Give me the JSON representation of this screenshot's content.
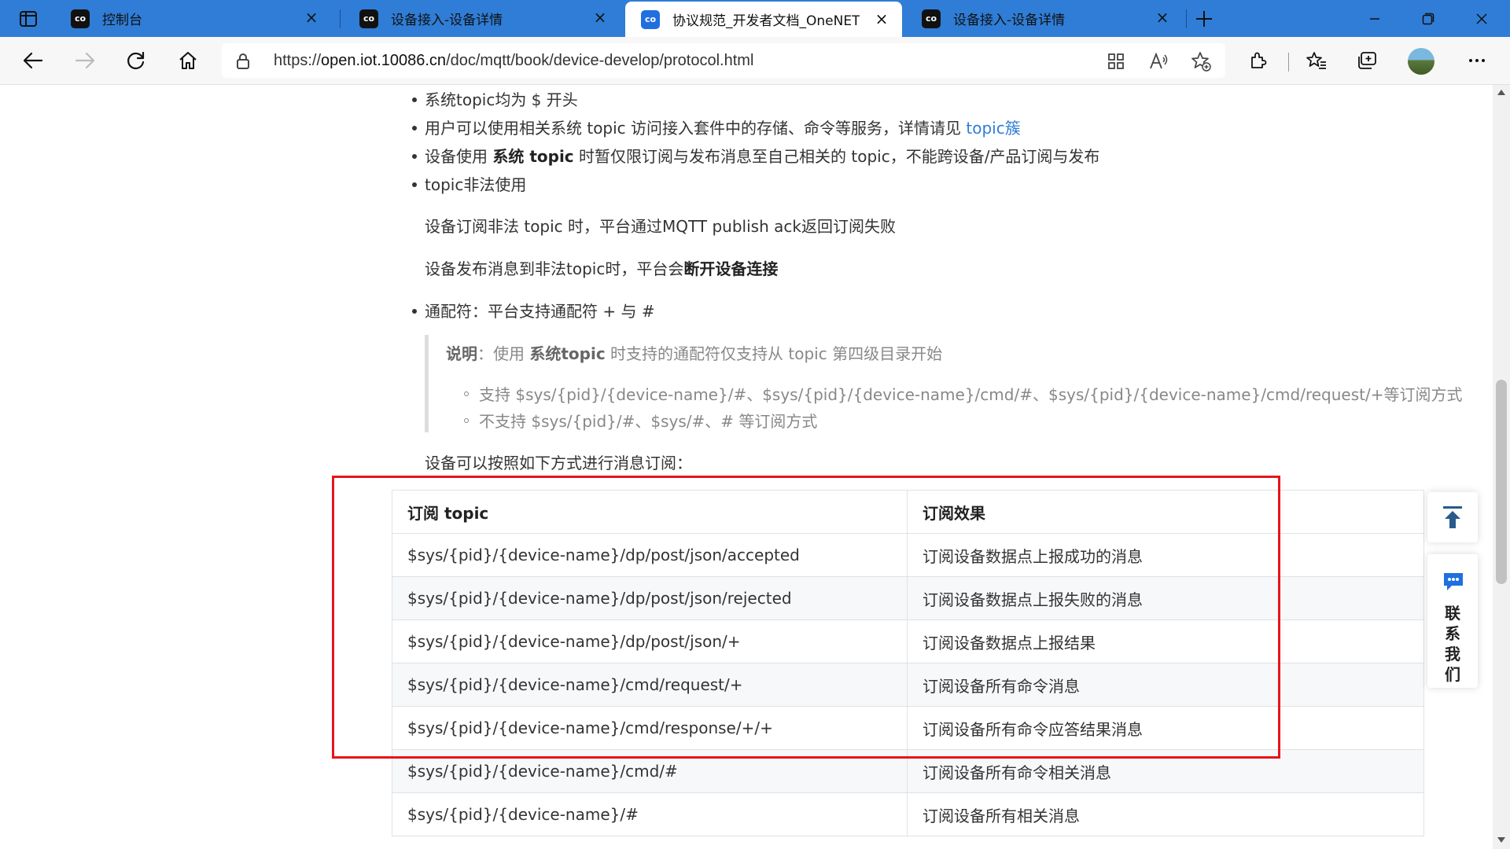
{
  "tabs": [
    {
      "favicon": "OneNET logo",
      "title": "控制台",
      "close": "×"
    },
    {
      "favicon": "OneNET logo",
      "title": "设备接入-设备详情",
      "close": "×"
    },
    {
      "favicon": "OneNET logo",
      "title": "协议规范_开发者文档_OneNET",
      "close": "×",
      "active": true
    },
    {
      "favicon": "OneNET logo",
      "title": "设备接入-设备详情",
      "close": "×"
    }
  ],
  "address_bar": {
    "url_prefix": "https://",
    "url_host": "open.iot.10086.cn",
    "url_path": "/doc/mqtt/book/device-develop/protocol.html"
  },
  "doc": {
    "bullet1": "系统topic均为 $ 开头",
    "bullet2_text": "用户可以使用相关系统 topic 访问接入套件中的存储、命令等服务，详情请见 ",
    "bullet2_link": "topic簇",
    "bullet3_pre": "设备使用 ",
    "bullet3_bold": "系统 topic",
    "bullet3_post": " 时暂仅限订阅与发布消息至自己相关的 topic，不能跨设备/产品订阅与发布",
    "bullet4": "topic非法使用",
    "para1": "设备订阅非法 topic 时，平台通过MQTT publish ack返回订阅失败",
    "para2_pre": "设备发布消息到非法topic时，平台会",
    "para2_bold": "断开设备连接",
    "bullet5": "通配符：平台支持通配符 + 与 #",
    "note_label": "说明",
    "note_mid1": "：使用 ",
    "note_bold": "系统topic",
    "note_mid2": " 时支持的通配符仅支持从 topic 第四级目录开始",
    "note_item1": "支持 $sys/{pid}/{device-name}/#、$sys/{pid}/{device-name}/cmd/#、$sys/{pid}/{device-name}/cmd/request/+等订阅方式",
    "note_item2": "不支持 $sys/{pid}/#、$sys/#、# 等订阅方式",
    "table_intro": "设备可以按照如下方式进行消息订阅："
  },
  "table": {
    "headers": [
      "订阅 topic",
      "订阅效果"
    ],
    "rows": [
      [
        "$sys/{pid}/{device-name}/dp/post/json/accepted",
        "订阅设备数据点上报成功的消息"
      ],
      [
        "$sys/{pid}/{device-name}/dp/post/json/rejected",
        "订阅设备数据点上报失败的消息"
      ],
      [
        "$sys/{pid}/{device-name}/dp/post/json/+",
        "订阅设备数据点上报结果"
      ],
      [
        "$sys/{pid}/{device-name}/cmd/request/+",
        "订阅设备所有命令消息"
      ],
      [
        "$sys/{pid}/{device-name}/cmd/response/+/+",
        "订阅设备所有命令应答结果消息"
      ],
      [
        "$sys/{pid}/{device-name}/cmd/#",
        "订阅设备所有命令相关消息"
      ],
      [
        "$sys/{pid}/{device-name}/#",
        "订阅设备所有相关消息"
      ]
    ]
  },
  "floating": {
    "contact_label": "联系我们"
  },
  "colors": {
    "tabbar": "#2f7dd6",
    "link": "#2f7dd6",
    "highlight": "#e8141b"
  }
}
